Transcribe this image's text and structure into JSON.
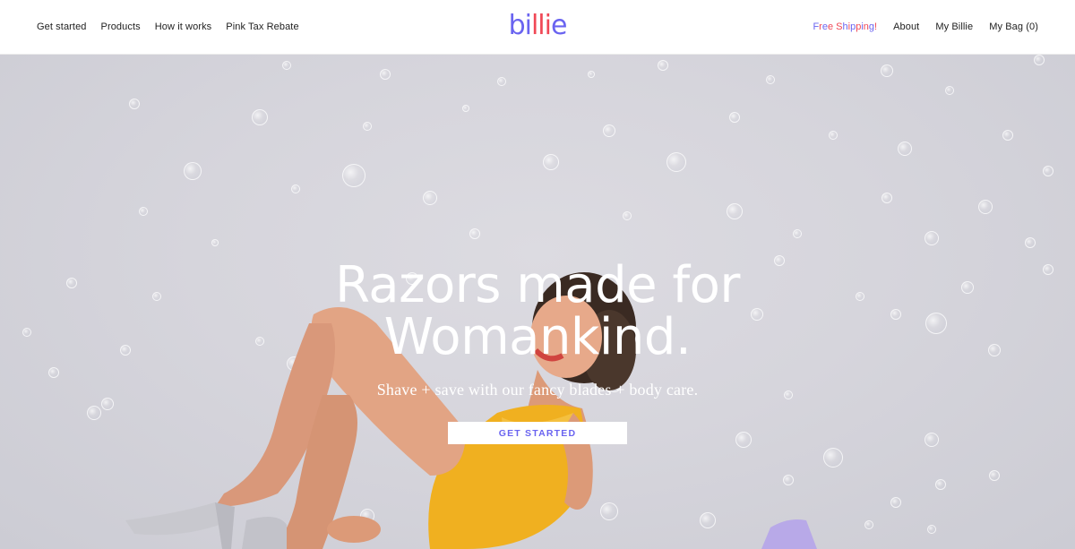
{
  "header": {
    "nav_left": [
      "Get started",
      "Products",
      "How it works",
      "Pink Tax Rebate"
    ],
    "logo": "billie",
    "free_shipping": "Free Shipping!",
    "nav_right": [
      "About",
      "My Billie",
      "My Bag (0)"
    ]
  },
  "hero": {
    "headline_line1": "Razors made for",
    "headline_line2": "Womankind.",
    "subheadline": "Shave + save with our fancy blades + body care.",
    "cta_label": "GET STARTED"
  },
  "colors": {
    "brand_purple": "#6a64f0",
    "brand_red": "#f04856",
    "hero_background": "#d6d5dc",
    "swimsuit": "#f0b020"
  }
}
